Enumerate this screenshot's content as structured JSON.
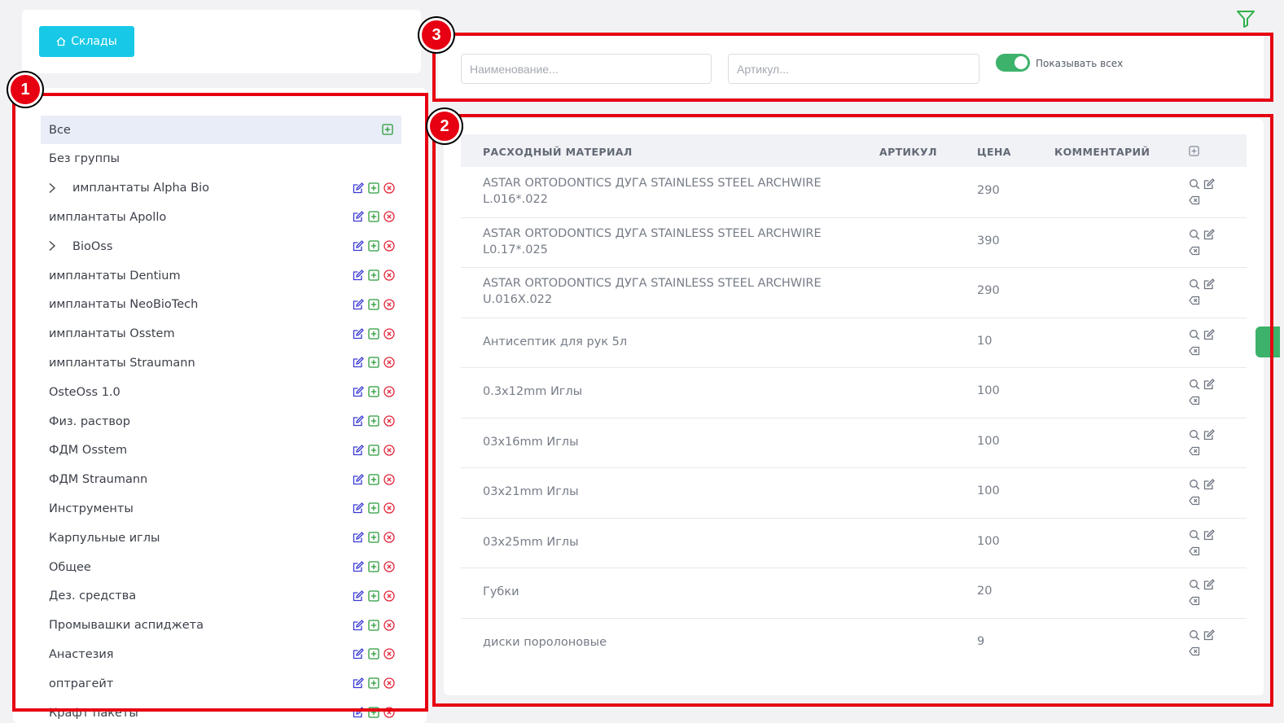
{
  "header": {
    "warehouses_button": "Склады"
  },
  "filters": {
    "name_placeholder": "Наименование...",
    "article_placeholder": "Артикул...",
    "show_all_label": "Показывать всех"
  },
  "annotations": [
    "1",
    "2",
    "3"
  ],
  "sidebar": {
    "items": [
      {
        "label": "Все",
        "active": true,
        "expandable": false,
        "actions": "add"
      },
      {
        "label": "Без группы",
        "active": false,
        "expandable": false,
        "actions": "none"
      },
      {
        "label": "имплантаты Alpha Bio",
        "active": false,
        "expandable": true,
        "actions": "all"
      },
      {
        "label": "имплантаты Apollo",
        "active": false,
        "expandable": false,
        "actions": "all"
      },
      {
        "label": "BioOss",
        "active": false,
        "expandable": true,
        "actions": "all"
      },
      {
        "label": "имплантаты Dentium",
        "active": false,
        "expandable": false,
        "actions": "all"
      },
      {
        "label": "имплантаты NeoBioTech",
        "active": false,
        "expandable": false,
        "actions": "all"
      },
      {
        "label": "имплантаты Osstem",
        "active": false,
        "expandable": false,
        "actions": "all"
      },
      {
        "label": "имплантаты Straumann",
        "active": false,
        "expandable": false,
        "actions": "all"
      },
      {
        "label": "OsteOss 1.0",
        "active": false,
        "expandable": false,
        "actions": "all"
      },
      {
        "label": "Физ. раствор",
        "active": false,
        "expandable": false,
        "actions": "all"
      },
      {
        "label": "ФДМ Osstem",
        "active": false,
        "expandable": false,
        "actions": "all"
      },
      {
        "label": "ФДМ Straumann",
        "active": false,
        "expandable": false,
        "actions": "all"
      },
      {
        "label": "Инструменты",
        "active": false,
        "expandable": false,
        "actions": "all"
      },
      {
        "label": "Карпульные иглы",
        "active": false,
        "expandable": false,
        "actions": "all"
      },
      {
        "label": "Общее",
        "active": false,
        "expandable": false,
        "actions": "all"
      },
      {
        "label": "Дез. средства",
        "active": false,
        "expandable": false,
        "actions": "all"
      },
      {
        "label": "Промывашки аспиджета",
        "active": false,
        "expandable": false,
        "actions": "all"
      },
      {
        "label": "Анастезия",
        "active": false,
        "expandable": false,
        "actions": "all"
      },
      {
        "label": "оптрагейт",
        "active": false,
        "expandable": false,
        "actions": "all"
      },
      {
        "label": "Крафт пакеты",
        "active": false,
        "expandable": false,
        "actions": "all"
      }
    ]
  },
  "table": {
    "columns": [
      "РАСХОДНЫЙ МАТЕРИАЛ",
      "АРТИКУЛ",
      "ЦЕНА",
      "КОММЕНТАРИЙ"
    ],
    "rows": [
      {
        "name": "ASTAR ORTODONTICS ДУГА STAINLESS STEEL ARCHWIRE L.016*.022",
        "article": "",
        "price": "290",
        "comment": ""
      },
      {
        "name": "ASTAR ORTODONTICS ДУГА STAINLESS STEEL ARCHWIRE L0.17*.025",
        "article": "",
        "price": "390",
        "comment": ""
      },
      {
        "name": "ASTAR ORTODONTICS ДУГА STAINLESS STEEL ARCHWIRE U.016X.022",
        "article": "",
        "price": "290",
        "comment": ""
      },
      {
        "name": "Антисептик для рук 5л",
        "article": "",
        "price": "10",
        "comment": ""
      },
      {
        "name": "0.3x12mm Иглы",
        "article": "",
        "price": "100",
        "comment": ""
      },
      {
        "name": "03x16mm Иглы",
        "article": "",
        "price": "100",
        "comment": ""
      },
      {
        "name": "03x21mm Иглы",
        "article": "",
        "price": "100",
        "comment": ""
      },
      {
        "name": "03x25mm Иглы",
        "article": "",
        "price": "100",
        "comment": ""
      },
      {
        "name": "Губки",
        "article": "",
        "price": "20",
        "comment": ""
      },
      {
        "name": "диски поролоновые",
        "article": "",
        "price": "9",
        "comment": ""
      }
    ]
  },
  "colors": {
    "accent_cyan": "#17c9e6",
    "toggle_green": "#3db26b",
    "annotation_red": "#e60012",
    "edit_blue": "#3a3ad6",
    "add_green": "#2a9a3a",
    "delete_red": "#e0243a"
  }
}
